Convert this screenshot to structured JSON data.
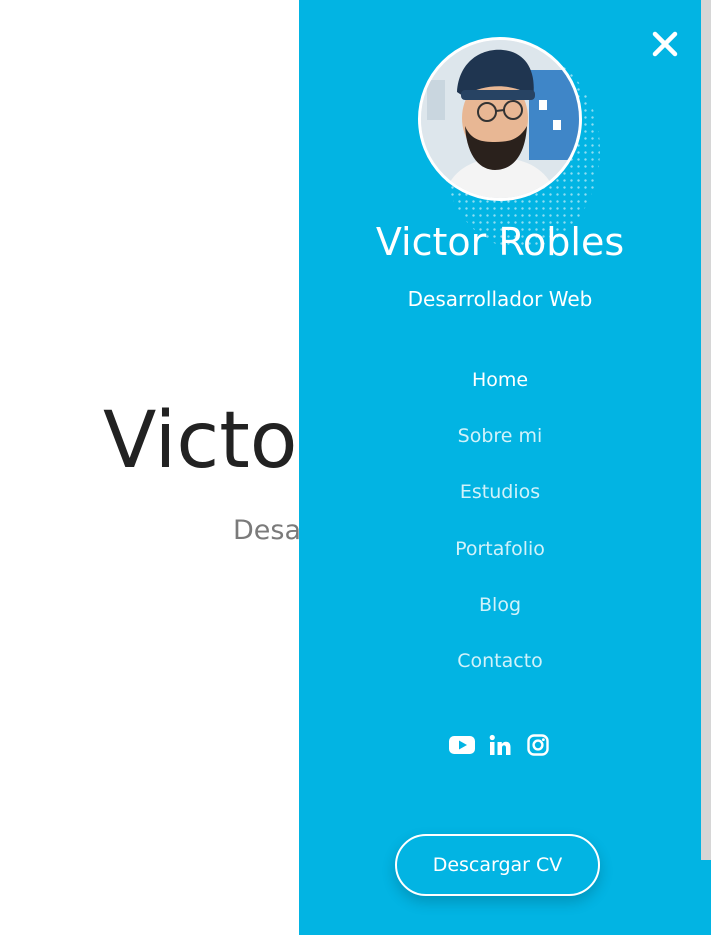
{
  "hero": {
    "name": "Victor Robles",
    "role": "Desarrollador Web"
  },
  "menu": {
    "close_icon": "close-icon",
    "profile": {
      "name": "Victor Robles",
      "role": "Desarrollador Web"
    },
    "items": [
      {
        "label": "Home",
        "active": true
      },
      {
        "label": "Sobre mi",
        "active": false
      },
      {
        "label": "Estudios",
        "active": false
      },
      {
        "label": "Portafolio",
        "active": false
      },
      {
        "label": "Blog",
        "active": false
      },
      {
        "label": "Contacto",
        "active": false
      }
    ],
    "socials": [
      "youtube-icon",
      "linkedin-icon",
      "instagram-icon"
    ],
    "cv_button": "Descargar CV"
  },
  "colors": {
    "accent": "#02b4e3",
    "text_dark": "#222222",
    "text_muted": "#7a7a7a"
  }
}
